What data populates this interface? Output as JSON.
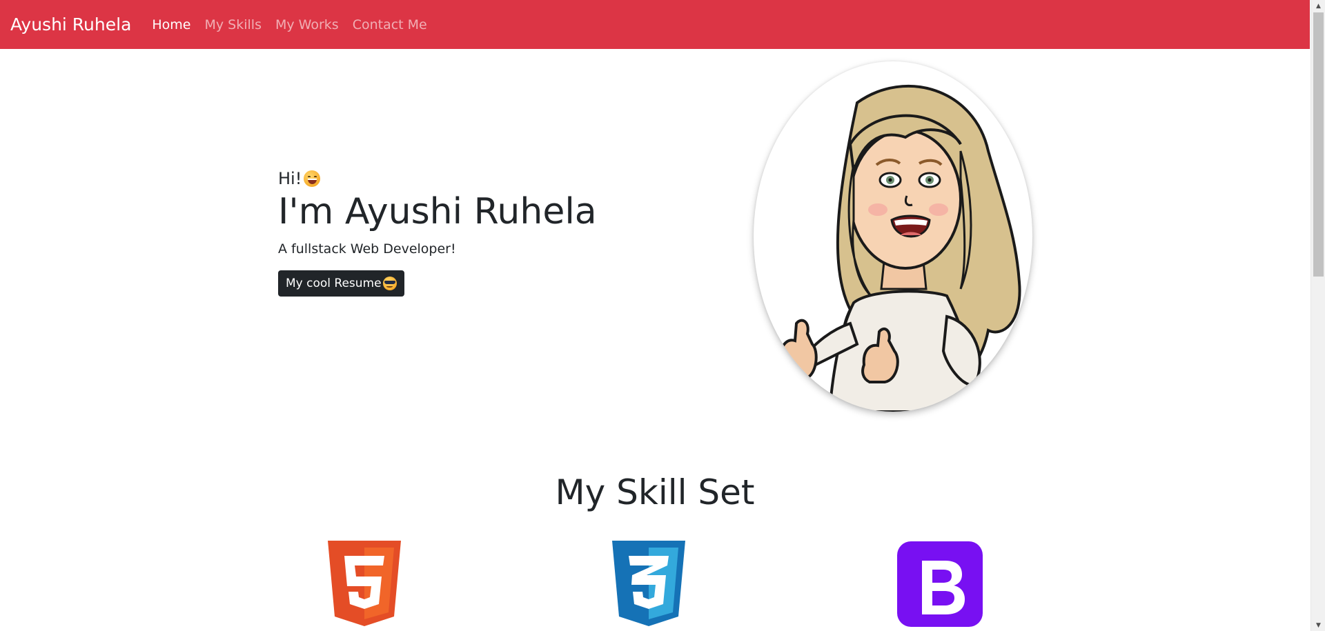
{
  "navbar": {
    "brand": "Ayushi Ruhela",
    "links": [
      {
        "label": "Home",
        "active": true
      },
      {
        "label": "My Skills",
        "active": false
      },
      {
        "label": "My Works",
        "active": false
      },
      {
        "label": "Contact Me",
        "active": false
      }
    ],
    "color": "#dc3545"
  },
  "hero": {
    "greeting": "Hi!",
    "greeting_emoji": "grinning-face-icon",
    "title": "I'm Ayushi Ruhela",
    "subtitle": "A fullstack Web Developer!",
    "resume_button": "My cool Resume",
    "resume_emoji": "sunglasses-face-icon",
    "avatar": "cartoon-avatar-image"
  },
  "skills": {
    "title": "My Skill Set",
    "icons": [
      "html5-icon",
      "css3-icon",
      "bootstrap-icon"
    ]
  },
  "colors": {
    "html5": "#e44d26",
    "css3": "#1572b6",
    "bootstrap": "#7810f2",
    "button": "#212529"
  }
}
